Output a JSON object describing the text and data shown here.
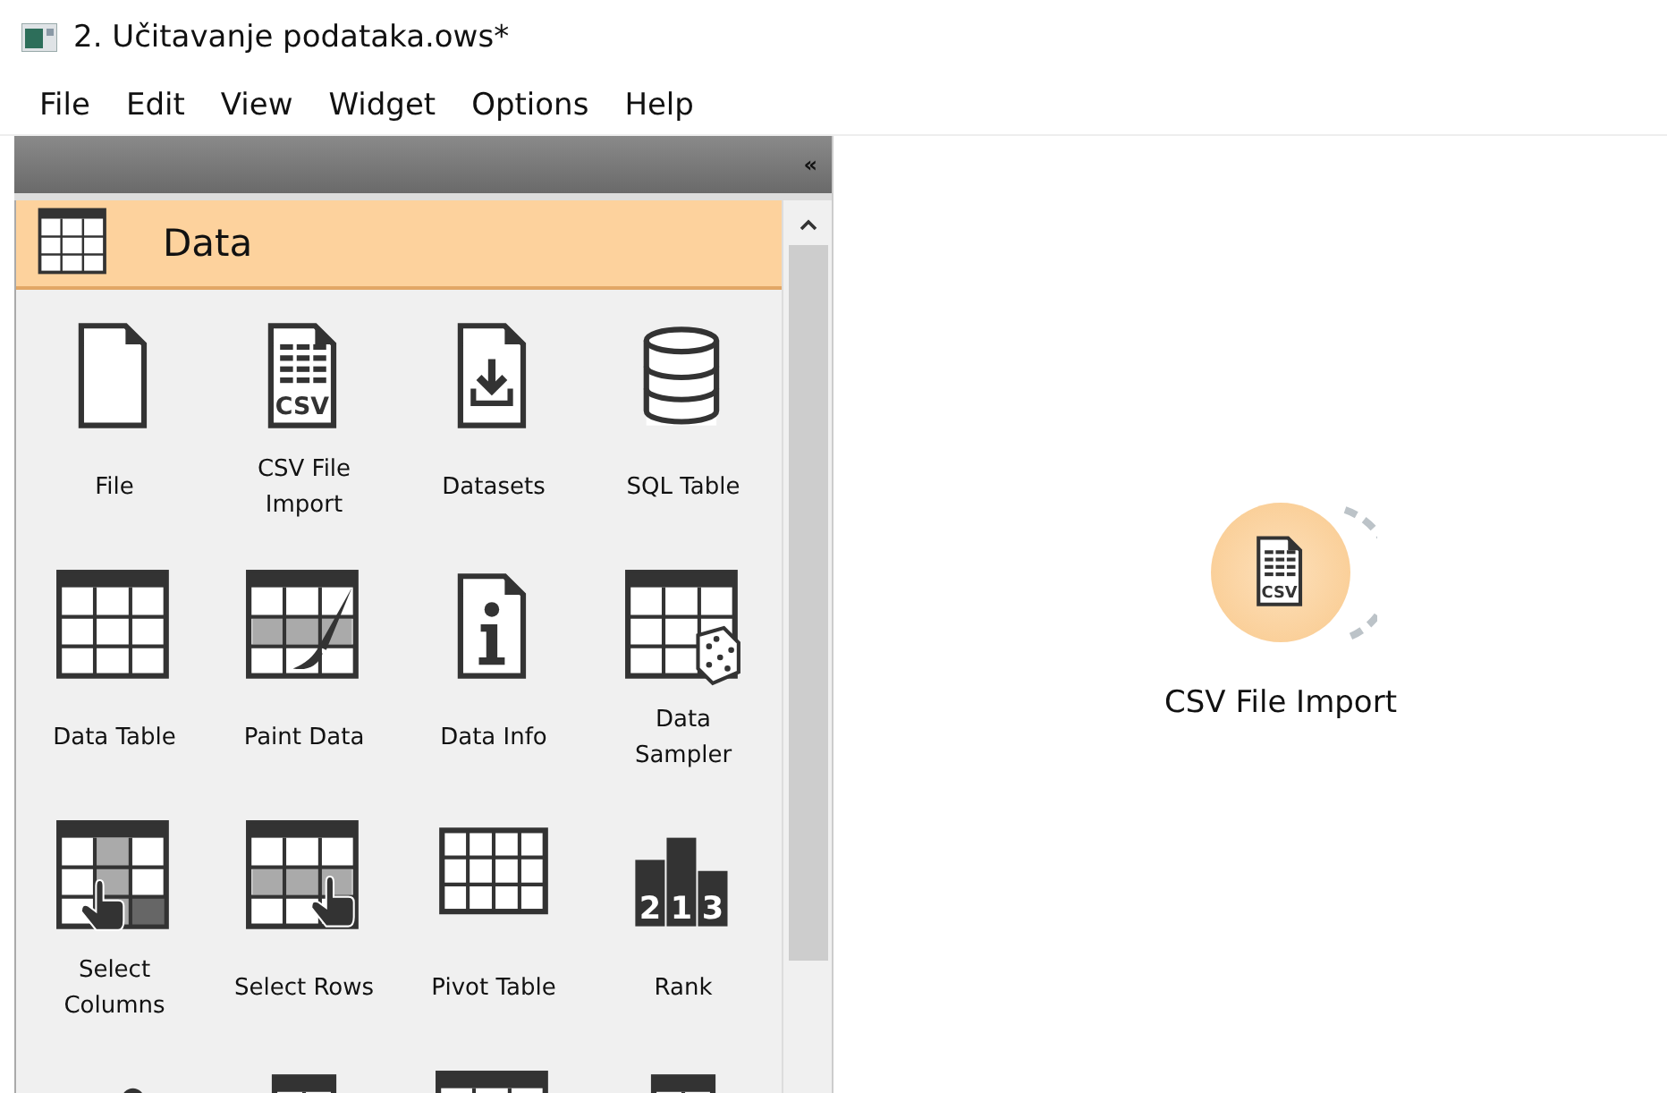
{
  "window": {
    "title": "2. Učitavanje podataka.ows*"
  },
  "menu": [
    "File",
    "Edit",
    "View",
    "Widget",
    "Options",
    "Help"
  ],
  "dock": {
    "collapse": "«",
    "category": {
      "label": "Data",
      "expanded": true
    },
    "widgets": [
      {
        "label": "File",
        "kind": "file"
      },
      {
        "label": "CSV File Import",
        "kind": "csv",
        "badge": "CSV"
      },
      {
        "label": "Datasets",
        "kind": "datasets"
      },
      {
        "label": "SQL Table",
        "kind": "database"
      },
      {
        "label": "Data Table",
        "kind": "table"
      },
      {
        "label": "Paint Data",
        "kind": "paint"
      },
      {
        "label": "Data Info",
        "kind": "info"
      },
      {
        "label": "Data Sampler",
        "kind": "sampler"
      },
      {
        "label": "Select Columns",
        "kind": "columns"
      },
      {
        "label": "Select Rows",
        "kind": "rows"
      },
      {
        "label": "Pivot Table",
        "kind": "pivot"
      },
      {
        "label": "Rank",
        "kind": "rank",
        "digits": [
          "2",
          "1",
          "3"
        ]
      },
      {
        "kind": "scatter"
      },
      {
        "kind": "split"
      },
      {
        "kind": "table"
      },
      {
        "kind": "split"
      }
    ]
  },
  "canvas": {
    "nodes": [
      {
        "label": "CSV File Import",
        "kind": "csv",
        "badge": "CSV"
      }
    ]
  }
}
